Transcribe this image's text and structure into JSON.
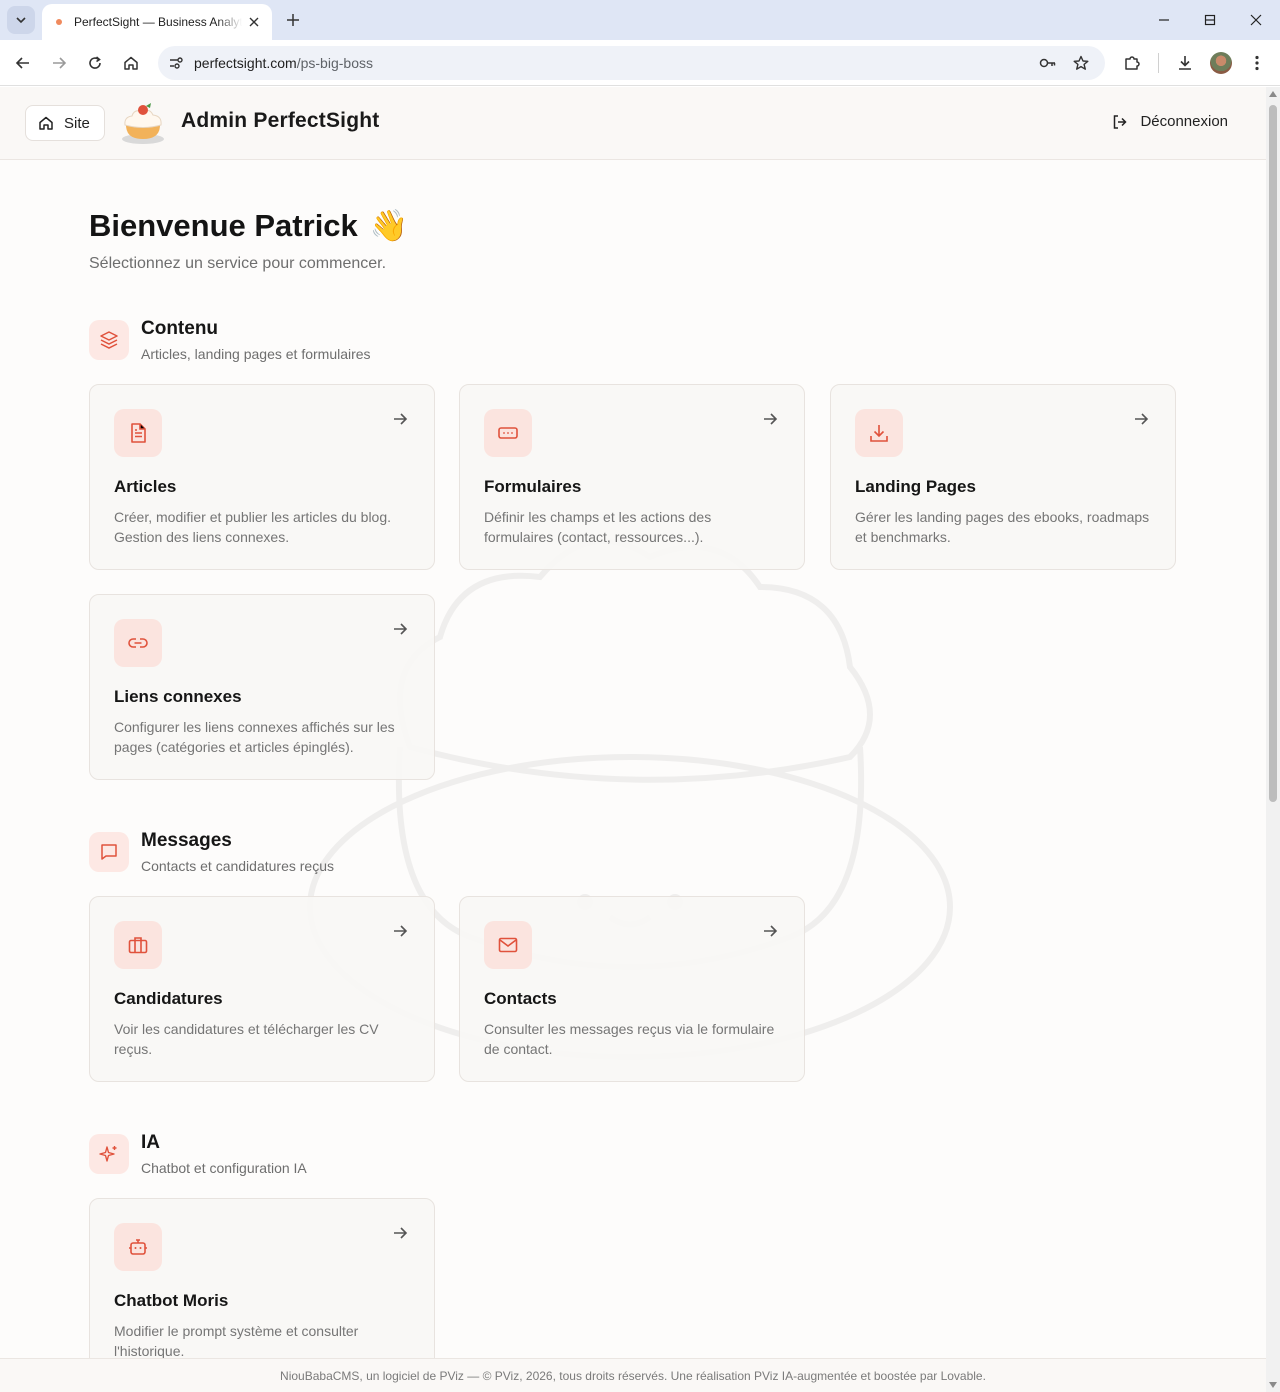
{
  "browser": {
    "tab_title": "PerfectSight — Business Analytics",
    "url_domain": "perfectsight.com",
    "url_path": "/ps-big-boss"
  },
  "header": {
    "site_label": "Site",
    "title": "Admin PerfectSight",
    "logout_label": "Déconnexion"
  },
  "welcome": {
    "title": "Bienvenue Patrick",
    "emoji": "👋",
    "subtitle": "Sélectionnez un service pour commencer."
  },
  "sections": [
    {
      "title": "Contenu",
      "subtitle": "Articles, landing pages et formulaires",
      "icon": "layers-icon",
      "cards": [
        {
          "title": "Articles",
          "desc": "Créer, modifier et publier les articles du blog. Gestion des liens connexes.",
          "icon": "file-text-icon"
        },
        {
          "title": "Formulaires",
          "desc": "Définir les champs et les actions des formulaires (contact, ressources...).",
          "icon": "form-input-icon"
        },
        {
          "title": "Landing Pages",
          "desc": "Gérer les landing pages des ebooks, roadmaps et benchmarks.",
          "icon": "download-icon"
        },
        {
          "title": "Liens connexes",
          "desc": "Configurer les liens connexes affichés sur les pages (catégories et articles épinglés).",
          "icon": "link-icon"
        }
      ]
    },
    {
      "title": "Messages",
      "subtitle": "Contacts et candidatures reçus",
      "icon": "message-square-icon",
      "cards": [
        {
          "title": "Candidatures",
          "desc": "Voir les candidatures et télécharger les CV reçus.",
          "icon": "briefcase-icon"
        },
        {
          "title": "Contacts",
          "desc": "Consulter les messages reçus via le formulaire de contact.",
          "icon": "mail-icon"
        }
      ]
    },
    {
      "title": "IA",
      "subtitle": "Chatbot et configuration IA",
      "icon": "sparkles-icon",
      "cards": [
        {
          "title": "Chatbot Moris",
          "desc": "Modifier le prompt système et consulter l'historique.",
          "icon": "bot-icon"
        }
      ]
    }
  ],
  "footer": {
    "text": "NiouBabaCMS, un logiciel de PViz — © PViz, 2026, tous droits réservés. Une réalisation PViz IA-augmentée et boostée par Lovable."
  },
  "colors": {
    "accent": "#e0523c",
    "icon_bg": "#fbe4df",
    "card_bg": "#f9f7f5"
  }
}
